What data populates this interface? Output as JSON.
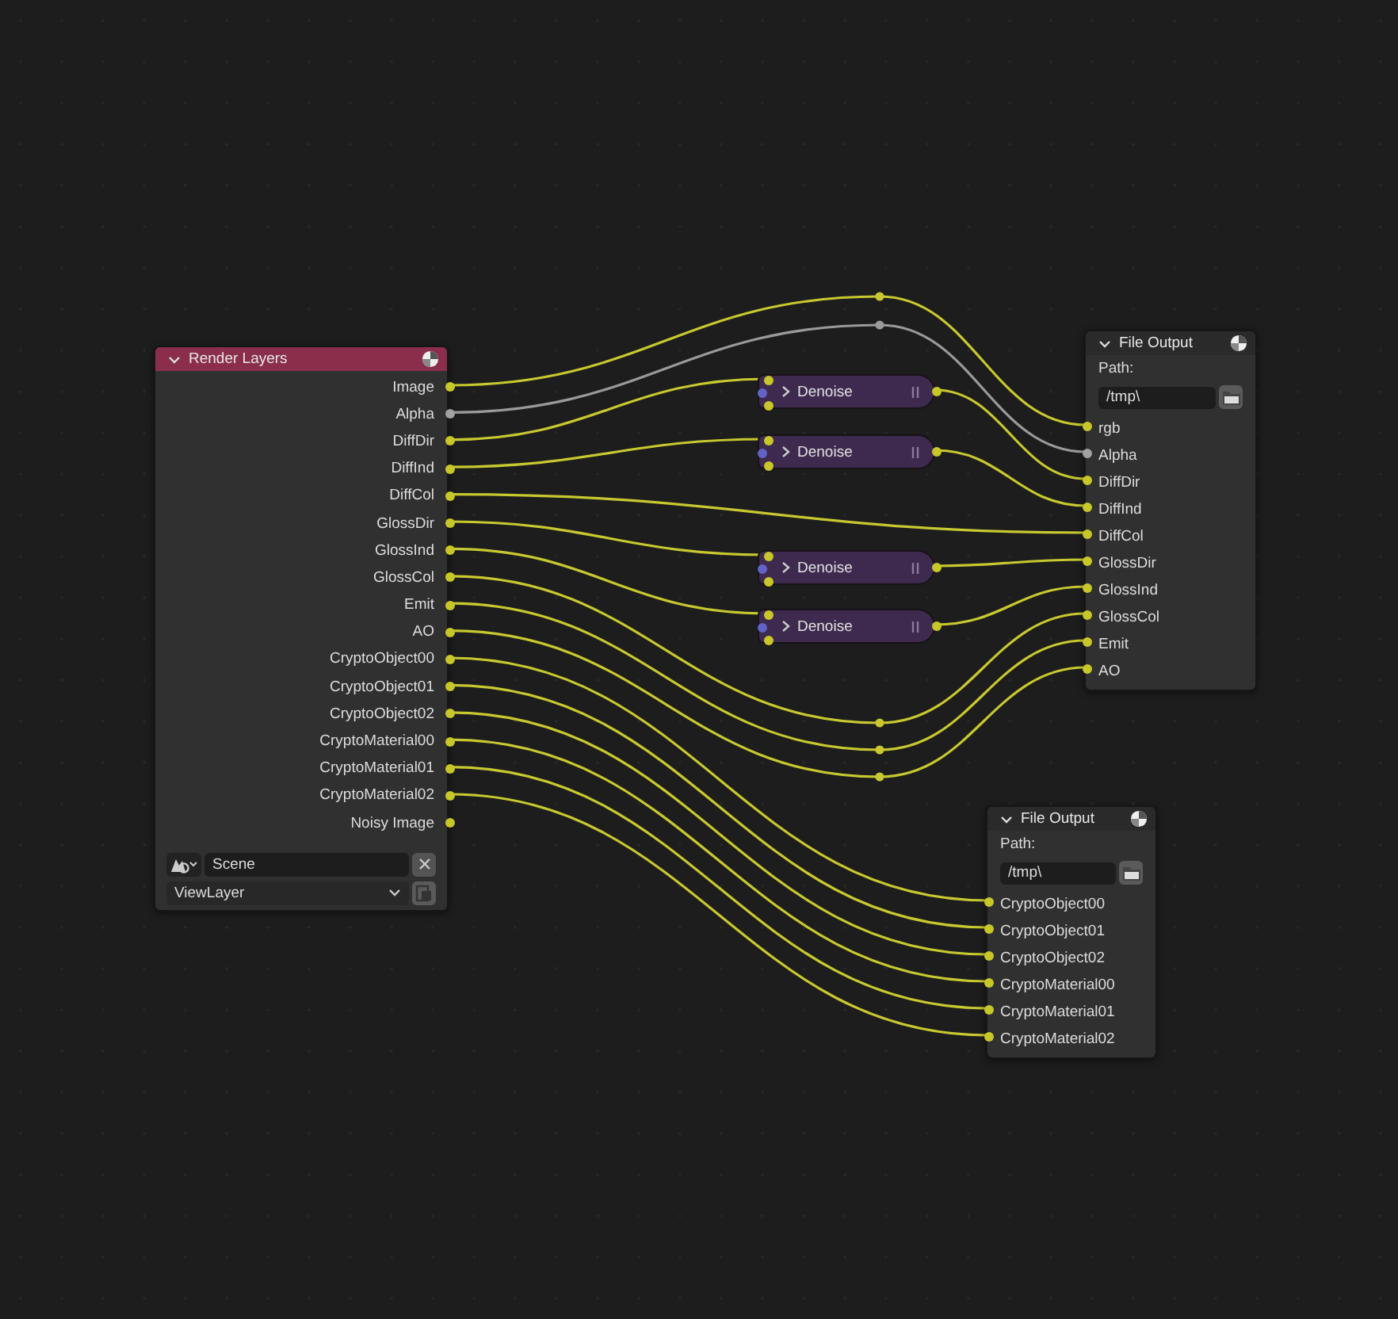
{
  "render_layers": {
    "title": "Render Layers",
    "outputs": [
      {
        "label": "Image",
        "kind": "color",
        "linked": true
      },
      {
        "label": "Alpha",
        "kind": "value",
        "linked": true
      },
      {
        "label": "DiffDir",
        "kind": "color",
        "linked": true
      },
      {
        "label": "DiffInd",
        "kind": "color",
        "linked": true
      },
      {
        "label": "DiffCol",
        "kind": "color",
        "linked": true
      },
      {
        "label": "GlossDir",
        "kind": "color",
        "linked": true
      },
      {
        "label": "GlossInd",
        "kind": "color",
        "linked": true
      },
      {
        "label": "GlossCol",
        "kind": "color",
        "linked": true
      },
      {
        "label": "Emit",
        "kind": "color",
        "linked": true
      },
      {
        "label": "AO",
        "kind": "color",
        "linked": true
      },
      {
        "label": "CryptoObject00",
        "kind": "color",
        "linked": true
      },
      {
        "label": "CryptoObject01",
        "kind": "color",
        "linked": true
      },
      {
        "label": "CryptoObject02",
        "kind": "color",
        "linked": true
      },
      {
        "label": "CryptoMaterial00",
        "kind": "color",
        "linked": true
      },
      {
        "label": "CryptoMaterial01",
        "kind": "color",
        "linked": true
      },
      {
        "label": "CryptoMaterial02",
        "kind": "color",
        "linked": true
      },
      {
        "label": "Noisy Image",
        "kind": "color",
        "linked": false
      }
    ],
    "scene": "Scene",
    "view_layer": "ViewLayer"
  },
  "denoise_nodes": [
    {
      "label": "Denoise"
    },
    {
      "label": "Denoise"
    },
    {
      "label": "Denoise"
    },
    {
      "label": "Denoise"
    }
  ],
  "file_outputs": [
    {
      "title": "File Output",
      "path_label": "Path:",
      "path": "/tmp\\",
      "inputs": [
        {
          "label": "rgb",
          "kind": "color"
        },
        {
          "label": "Alpha",
          "kind": "value"
        },
        {
          "label": "DiffDir",
          "kind": "color"
        },
        {
          "label": "DiffInd",
          "kind": "color"
        },
        {
          "label": "DiffCol",
          "kind": "color"
        },
        {
          "label": "GlossDir",
          "kind": "color"
        },
        {
          "label": "GlossInd",
          "kind": "color"
        },
        {
          "label": "GlossCol",
          "kind": "color"
        },
        {
          "label": "Emit",
          "kind": "color"
        },
        {
          "label": "AO",
          "kind": "color"
        }
      ]
    },
    {
      "title": "File Output",
      "path_label": "Path:",
      "path": "/tmp\\",
      "inputs": [
        {
          "label": "CryptoObject00",
          "kind": "color"
        },
        {
          "label": "CryptoObject01",
          "kind": "color"
        },
        {
          "label": "CryptoObject02",
          "kind": "color"
        },
        {
          "label": "CryptoMaterial00",
          "kind": "color"
        },
        {
          "label": "CryptoMaterial01",
          "kind": "color"
        },
        {
          "label": "CryptoMaterial02",
          "kind": "color"
        }
      ]
    }
  ]
}
